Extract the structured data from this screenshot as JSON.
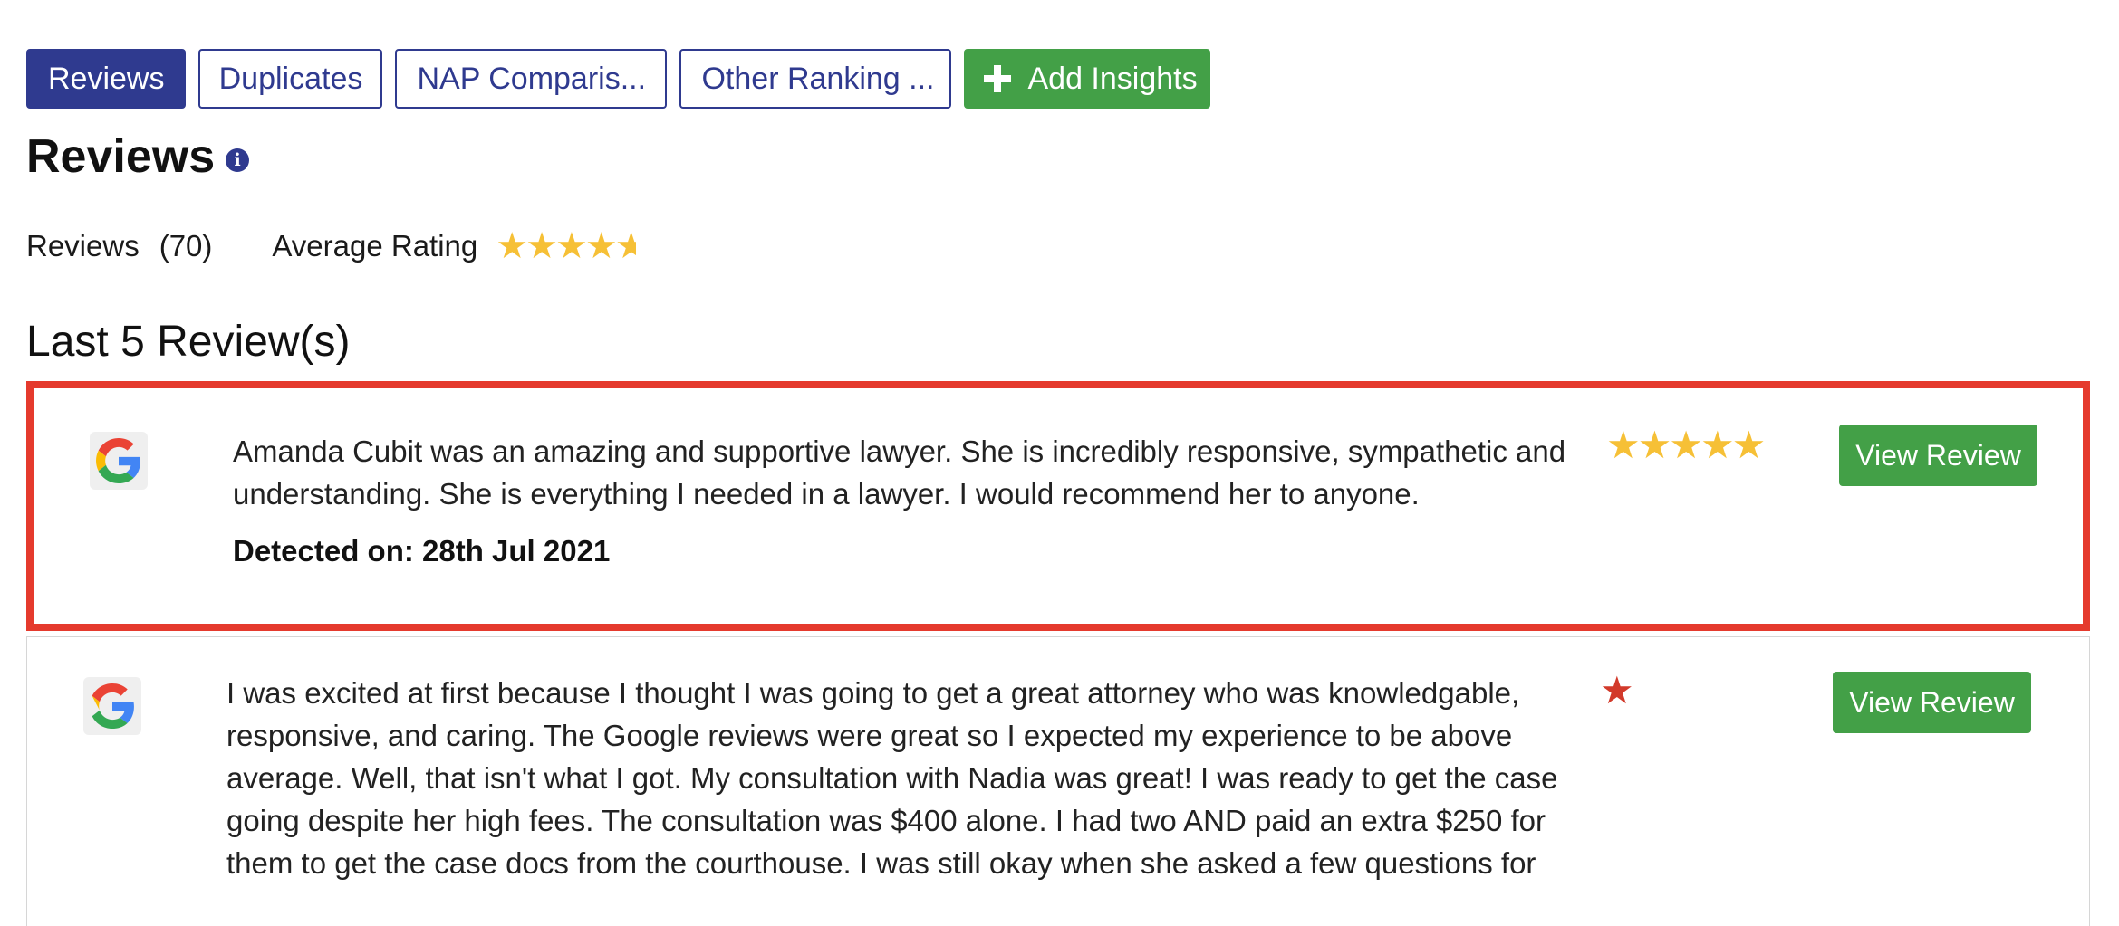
{
  "tabs": [
    {
      "label": "Reviews",
      "active": true
    },
    {
      "label": "Duplicates"
    },
    {
      "label": "NAP Comparis..."
    },
    {
      "label": "Other Ranking ..."
    }
  ],
  "add_insights_label": "Add Insights",
  "section_title": "Reviews",
  "summary": {
    "reviews_label": "Reviews",
    "reviews_count": "(70)",
    "average_label": "Average Rating",
    "average_rating": 4.5,
    "max_rating": 5
  },
  "last_reviews_title": "Last 5 Review(s)",
  "reviews": [
    {
      "source_icon": "google-icon",
      "text": "Amanda Cubit was an amazing and supportive lawyer. She is incredibly responsive, sympathetic and understanding. She is everything I needed in a lawyer. I would recommend her to anyone.",
      "detected": "Detected on: 28th Jul 2021",
      "rating": 5,
      "button_label": "View Review"
    },
    {
      "source_icon": "google-icon",
      "text": "I was excited at first because I thought I was going to get a great attorney who was knowledgable, responsive, and caring. The Google reviews were great so I expected my experience to be above average. Well, that isn't what I got. My consultation with Nadia was great! I was ready to get the case going despite her high fees. The consultation was $400 alone. I had two AND paid an extra $250 for them to get the case docs from the courthouse. I was still okay when she asked a few questions for",
      "rating": 1,
      "button_label": "View Review"
    }
  ],
  "colors": {
    "primary": "#2f3a8f",
    "accent_green": "#43a047",
    "highlight_border": "#e53a2d",
    "star_gold": "#f6c036",
    "star_red": "#d23a2b"
  }
}
